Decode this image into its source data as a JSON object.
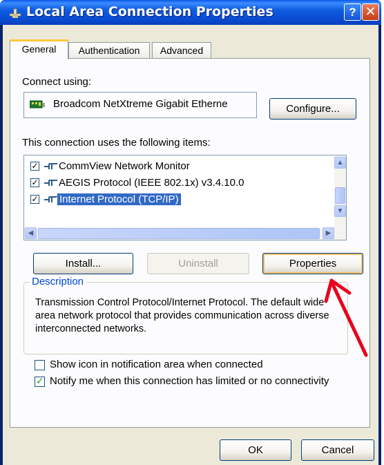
{
  "window": {
    "title": "Local Area Connection Properties",
    "help_glyph": "?",
    "close_glyph": "✕"
  },
  "tabs": [
    {
      "label": "General",
      "active": true
    },
    {
      "label": "Authentication",
      "active": false
    },
    {
      "label": "Advanced",
      "active": false
    }
  ],
  "connect_using": {
    "label": "Connect using:",
    "adapter": "Broadcom NetXtreme Gigabit Etherne",
    "configure_button": "Configure..."
  },
  "items": {
    "label": "This connection uses the following items:",
    "list": [
      {
        "label": "CommView Network Monitor",
        "checked": true,
        "selected": false
      },
      {
        "label": "AEGIS Protocol (IEEE 802.1x) v3.4.10.0",
        "checked": true,
        "selected": false
      },
      {
        "label": "Internet Protocol (TCP/IP)",
        "checked": true,
        "selected": true
      }
    ]
  },
  "buttons": {
    "install": "Install...",
    "uninstall": "Uninstall",
    "properties": "Properties"
  },
  "description": {
    "title": "Description",
    "text": "Transmission Control Protocol/Internet Protocol. The default wide area network protocol that provides communication across diverse interconnected networks."
  },
  "options": [
    {
      "label": "Show icon in notification area when connected",
      "checked": false
    },
    {
      "label": "Notify me when this connection has limited or no connectivity",
      "checked": true
    }
  ],
  "footer": {
    "ok": "OK",
    "cancel": "Cancel"
  },
  "colors": {
    "title_bar": "#0a4fd6",
    "selection": "#316ac5",
    "annotation_arrow": "#e8001c"
  }
}
